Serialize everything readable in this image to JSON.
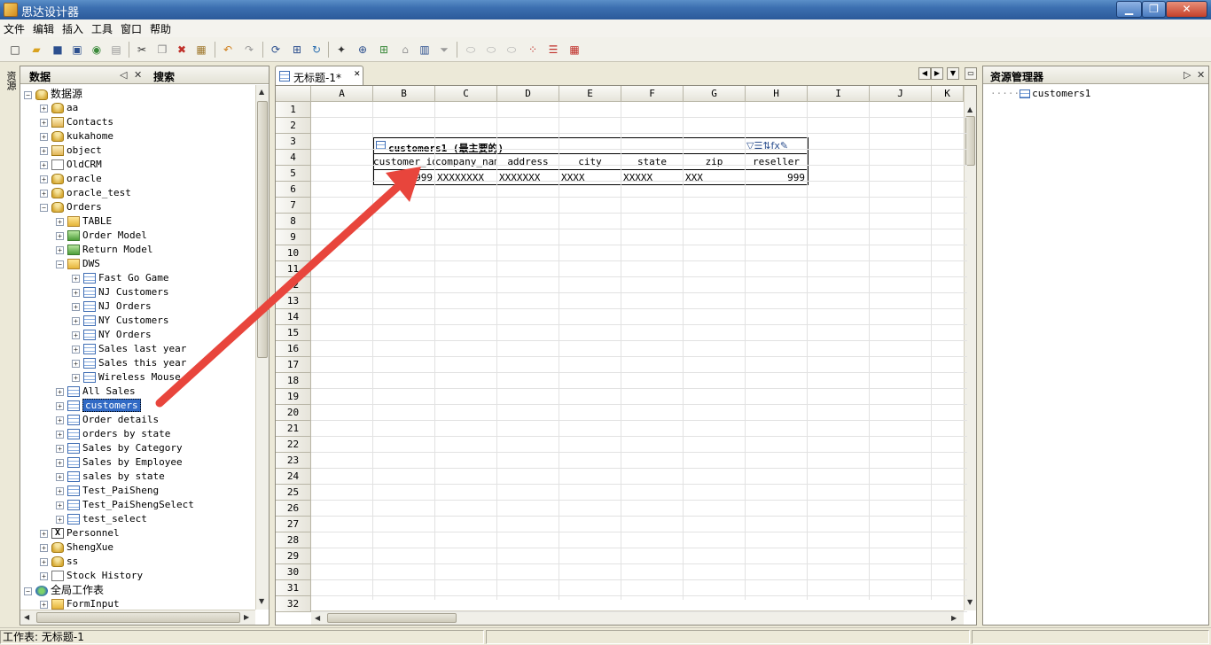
{
  "window": {
    "title": "思达设计器",
    "min": "▁",
    "max": "❐",
    "close": "✕"
  },
  "menu": [
    "文件",
    "编辑",
    "插入",
    "工具",
    "窗口",
    "帮助"
  ],
  "left_strip": {
    "label": "资源"
  },
  "data_panel": {
    "tab_data": "数据",
    "tab_search": "搜索",
    "ctrl_pin": "◁",
    "ctrl_close": "✕",
    "tree": [
      {
        "label": "数据源",
        "level": 0,
        "icon": "db",
        "exp": "−"
      },
      {
        "label": "aa",
        "level": 1,
        "icon": "db",
        "exp": "+"
      },
      {
        "label": "Contacts",
        "level": 1,
        "icon": "contacts",
        "exp": "+"
      },
      {
        "label": "kukahome",
        "level": 1,
        "icon": "db",
        "exp": "+"
      },
      {
        "label": "object",
        "level": 1,
        "icon": "contacts",
        "exp": "+"
      },
      {
        "label": "OldCRM",
        "level": 1,
        "icon": "doc",
        "exp": "+"
      },
      {
        "label": "oracle",
        "level": 1,
        "icon": "db",
        "exp": "+"
      },
      {
        "label": "oracle_test",
        "level": 1,
        "icon": "db",
        "exp": "+"
      },
      {
        "label": "Orders",
        "level": 1,
        "icon": "db",
        "exp": "−"
      },
      {
        "label": "TABLE",
        "level": 2,
        "icon": "folder",
        "exp": "+"
      },
      {
        "label": "Order Model",
        "level": 2,
        "icon": "folder-green",
        "exp": "+"
      },
      {
        "label": "Return Model",
        "level": 2,
        "icon": "folder-green",
        "exp": "+"
      },
      {
        "label": "DWS",
        "level": 2,
        "icon": "folder",
        "exp": "−"
      },
      {
        "label": "Fast Go Game",
        "level": 3,
        "icon": "table",
        "exp": "+"
      },
      {
        "label": "NJ Customers",
        "level": 3,
        "icon": "table",
        "exp": "+"
      },
      {
        "label": "NJ Orders",
        "level": 3,
        "icon": "table",
        "exp": "+"
      },
      {
        "label": "NY Customers",
        "level": 3,
        "icon": "table",
        "exp": "+"
      },
      {
        "label": "NY Orders",
        "level": 3,
        "icon": "table",
        "exp": "+"
      },
      {
        "label": "Sales last year",
        "level": 3,
        "icon": "table",
        "exp": "+"
      },
      {
        "label": "Sales this year",
        "level": 3,
        "icon": "table",
        "exp": "+"
      },
      {
        "label": "Wireless Mouse",
        "level": 3,
        "icon": "table",
        "exp": "+"
      },
      {
        "label": "All Sales",
        "level": 2,
        "icon": "table",
        "exp": "+"
      },
      {
        "label": "customers",
        "level": 2,
        "icon": "table",
        "exp": "+",
        "selected": true
      },
      {
        "label": "Order details",
        "level": 2,
        "icon": "table",
        "exp": "+"
      },
      {
        "label": "orders by state",
        "level": 2,
        "icon": "table",
        "exp": "+"
      },
      {
        "label": "Sales by Category",
        "level": 2,
        "icon": "table",
        "exp": "+"
      },
      {
        "label": "Sales by Employee",
        "level": 2,
        "icon": "table",
        "exp": "+"
      },
      {
        "label": "sales by state",
        "level": 2,
        "icon": "table",
        "exp": "+"
      },
      {
        "label": "Test_PaiSheng",
        "level": 2,
        "icon": "table",
        "exp": "+"
      },
      {
        "label": "Test_PaiShengSelect",
        "level": 2,
        "icon": "table",
        "exp": "+"
      },
      {
        "label": "test_select",
        "level": 2,
        "icon": "table",
        "exp": "+"
      },
      {
        "label": "Personnel",
        "level": 1,
        "icon": "xls",
        "exp": "+"
      },
      {
        "label": "ShengXue",
        "level": 1,
        "icon": "db",
        "exp": "+"
      },
      {
        "label": "ss",
        "level": 1,
        "icon": "db",
        "exp": "+"
      },
      {
        "label": "Stock History",
        "level": 1,
        "icon": "doc",
        "exp": "+"
      },
      {
        "label": "全局工作表",
        "level": 0,
        "icon": "globe",
        "exp": "−"
      },
      {
        "label": "FormInput",
        "level": 1,
        "icon": "folder",
        "exp": "+"
      }
    ]
  },
  "sheet": {
    "tab_label": "无标题-1*",
    "tab_close": "✕",
    "columns": [
      "A",
      "B",
      "C",
      "D",
      "E",
      "F",
      "G",
      "H",
      "I",
      "J",
      "K"
    ],
    "rows": [
      "1",
      "2",
      "3",
      "4",
      "5",
      "6",
      "7",
      "8",
      "9",
      "10",
      "11",
      "12",
      "13",
      "14",
      "15",
      "16",
      "17",
      "18",
      "19",
      "20",
      "21",
      "22",
      "23",
      "24",
      "25",
      "26",
      "27",
      "28",
      "29",
      "30",
      "31",
      "32"
    ],
    "dataset": {
      "title": "customers1 (最主要的)",
      "headers": [
        "customer_id",
        "company_name",
        "address",
        "city",
        "state",
        "zip",
        "reseller"
      ],
      "values": [
        "999",
        "XXXXXXXX",
        "XXXXXXX",
        "XXXX",
        "XXXXX",
        "XXX",
        "999"
      ],
      "tools": "▽☰⇅fx✎"
    }
  },
  "resource_panel": {
    "title": "资源管理器",
    "ctrl_pin": "▷",
    "ctrl_close": "✕",
    "item": "customers1"
  },
  "status": {
    "text": "工作表: 无标题-1"
  },
  "annotation": {
    "color": "#e8453c"
  }
}
